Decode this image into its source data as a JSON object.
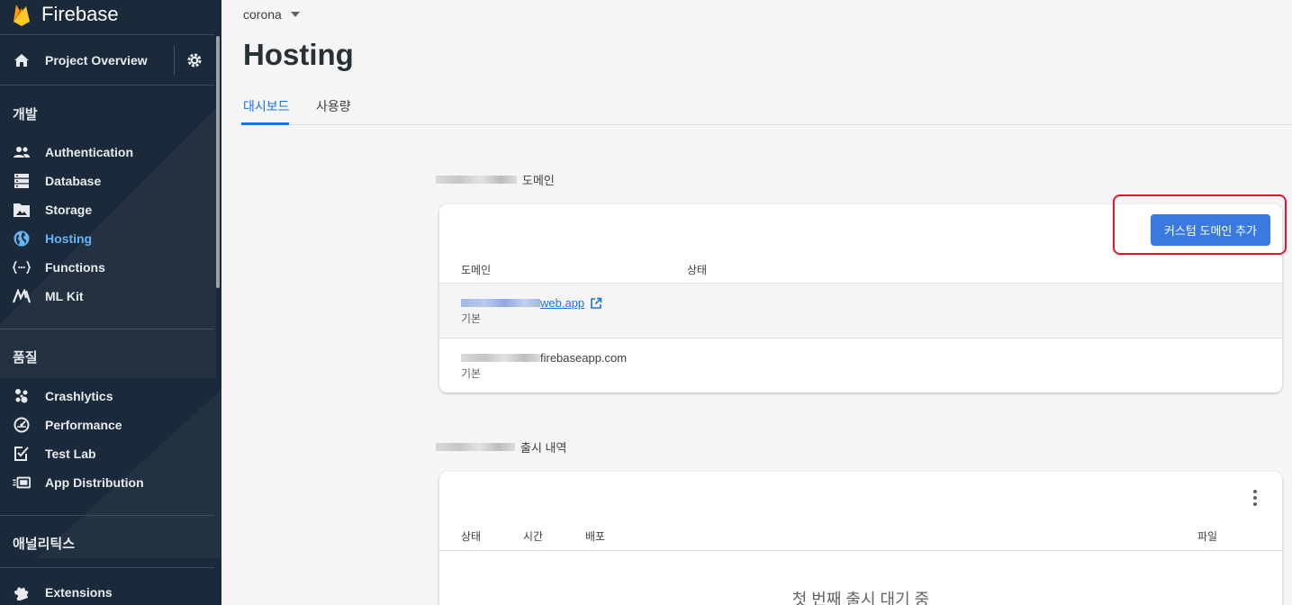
{
  "brand": {
    "name": "Firebase"
  },
  "project": {
    "name": "corona"
  },
  "sidebar": {
    "overview_label": "Project Overview",
    "sections": [
      {
        "title": "개발"
      },
      {
        "title": "품질"
      },
      {
        "title": "애널리틱스"
      }
    ],
    "develop_items": [
      {
        "label": "Authentication",
        "icon": "people-icon"
      },
      {
        "label": "Database",
        "icon": "database-icon"
      },
      {
        "label": "Storage",
        "icon": "image-icon"
      },
      {
        "label": "Hosting",
        "icon": "globe-icon",
        "active": true
      },
      {
        "label": "Functions",
        "icon": "functions-icon"
      },
      {
        "label": "ML Kit",
        "icon": "ml-kit-icon"
      }
    ],
    "quality_items": [
      {
        "label": "Crashlytics",
        "icon": "crashlytics-icon"
      },
      {
        "label": "Performance",
        "icon": "speedometer-icon"
      },
      {
        "label": "Test Lab",
        "icon": "test-lab-icon"
      },
      {
        "label": "App Distribution",
        "icon": "app-distribution-icon"
      }
    ],
    "extensions_label": "Extensions"
  },
  "page": {
    "title": "Hosting",
    "tabs": [
      {
        "label": "대시보드",
        "active": true
      },
      {
        "label": "사용량"
      }
    ]
  },
  "domains": {
    "section_label_suffix": "도메인",
    "add_button": "커스텀 도메인 추가",
    "columns": [
      "도메인",
      "상태"
    ],
    "rows": [
      {
        "domain_visible": "web.app",
        "sub": "기본",
        "link": true
      },
      {
        "domain_visible": "firebaseapp.com",
        "sub": "기본",
        "link": false
      }
    ]
  },
  "releases": {
    "section_label_suffix": "출시 내역",
    "columns": [
      "상태",
      "시간",
      "배포",
      "파일"
    ],
    "empty_text": "첫 번째 출시 대기 중"
  },
  "colors": {
    "sidebar_bg": "#1b2a3a",
    "accent": "#1a73e8",
    "button": "#3979e0",
    "highlight": "#e0182a"
  }
}
